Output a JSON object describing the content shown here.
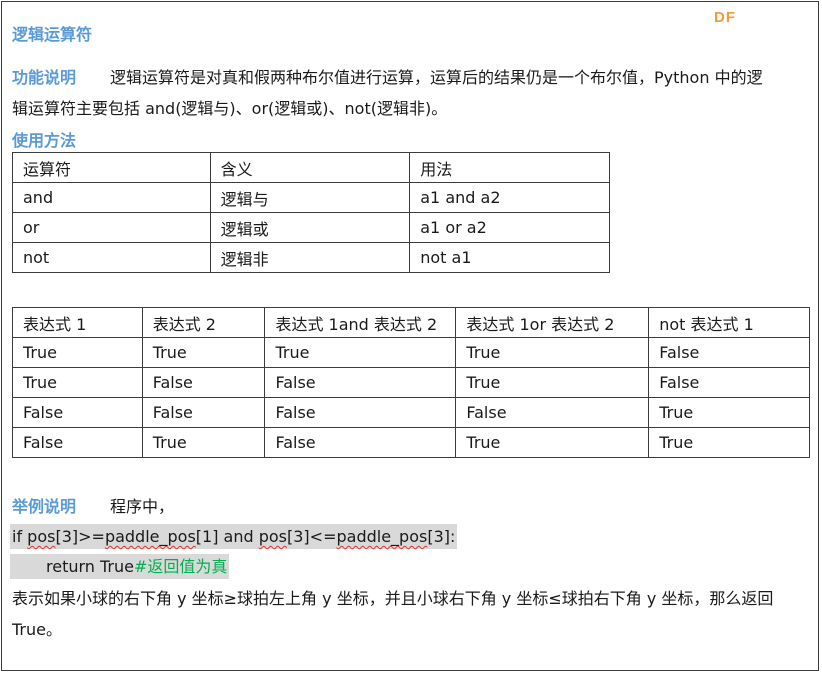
{
  "brand": {
    "logo_text": "DF"
  },
  "section_title": "逻辑运算符",
  "function_heading": "功能说明",
  "function_text_line1": "逻辑运算符是对真和假两种布尔值进行运算，运算后的结果仍是一个布尔值，Python 中的逻",
  "function_text_line2": "辑运算符主要包括 and(逻辑与)、or(逻辑或)、not(逻辑非)。",
  "usage_heading": "使用方法",
  "operator_table": {
    "headers": [
      "运算符",
      "含义",
      "用法"
    ],
    "rows": [
      [
        "and",
        "逻辑与",
        "a1 and a2"
      ],
      [
        "or",
        "逻辑或",
        "a1 or a2"
      ],
      [
        "not",
        "逻辑非",
        "not a1"
      ]
    ]
  },
  "truth_table": {
    "headers": [
      "表达式 1",
      "表达式 2",
      "表达式 1and 表达式 2",
      "表达式 1or 表达式 2",
      "not 表达式 1"
    ],
    "rows": [
      [
        "True",
        "True",
        "True",
        "True",
        "False"
      ],
      [
        "True",
        "False",
        "False",
        "True",
        "False"
      ],
      [
        "False",
        "False",
        "False",
        "False",
        "True"
      ],
      [
        "False",
        "True",
        "False",
        "True",
        "True"
      ]
    ]
  },
  "example_heading": "举例说明",
  "example_intro": "程序中，",
  "code": {
    "l1_a": "if ",
    "l1_b": "pos",
    "l1_c": "[3]>=",
    "l1_d": "paddle_pos",
    "l1_e": "[1] and ",
    "l1_f": "pos",
    "l1_g": "[3]<=",
    "l1_h": "paddle_pos",
    "l1_i": "[3]:",
    "l2_code": "return True",
    "l2_comment": "#返回值为真"
  },
  "explanation_line1": "表示如果小球的右下角 y 坐标≥球拍左上角 y 坐标，并且小球右下角 y 坐标≤球拍右下角 y 坐标，那么返回",
  "explanation_line2": "True。"
}
